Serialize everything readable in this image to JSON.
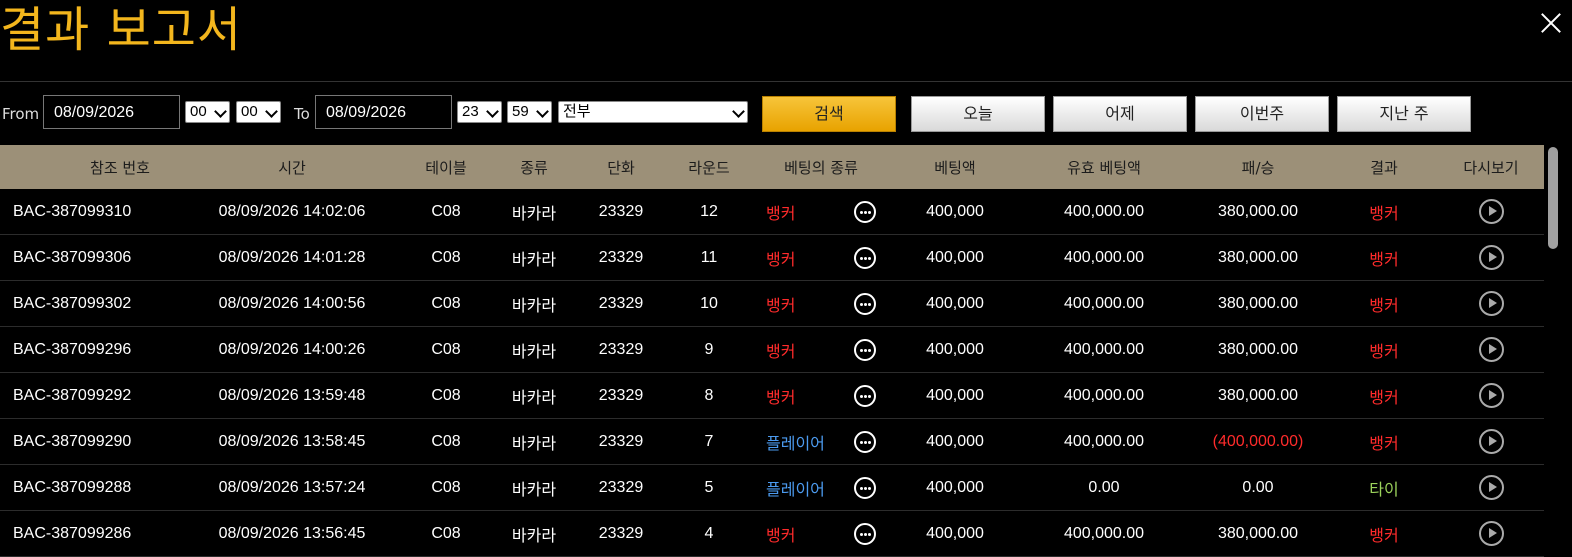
{
  "title": "결과 보고서",
  "filter": {
    "from_label": "From",
    "from_date": "08/09/2026",
    "from_hour": "00",
    "from_min": "00",
    "to_label": "To",
    "to_date": "08/09/2026",
    "to_hour": "23",
    "to_min": "59",
    "type_value": "전부",
    "search_label": "검색",
    "today_label": "오늘",
    "yesterday_label": "어제",
    "this_week_label": "이번주",
    "last_week_label": "지난 주"
  },
  "columns": [
    "참조 번호",
    "시간",
    "테이블",
    "종류",
    "단화",
    "라운드",
    "베팅의 종류",
    "베팅액",
    "유효 베팅액",
    "패/승",
    "결과",
    "다시보기"
  ],
  "rows": [
    {
      "ref": "BAC-387099310",
      "time": "08/09/2026 14:02:06",
      "table": "C08",
      "kind": "바카라",
      "shoe": "23329",
      "round": "12",
      "bet": "뱅커",
      "bet_color": "red",
      "amount": "400,000",
      "valid": "400,000.00",
      "winloss": "380,000.00",
      "winloss_color": "white",
      "result": "뱅커",
      "result_color": "red"
    },
    {
      "ref": "BAC-387099306",
      "time": "08/09/2026 14:01:28",
      "table": "C08",
      "kind": "바카라",
      "shoe": "23329",
      "round": "11",
      "bet": "뱅커",
      "bet_color": "red",
      "amount": "400,000",
      "valid": "400,000.00",
      "winloss": "380,000.00",
      "winloss_color": "white",
      "result": "뱅커",
      "result_color": "red"
    },
    {
      "ref": "BAC-387099302",
      "time": "08/09/2026 14:00:56",
      "table": "C08",
      "kind": "바카라",
      "shoe": "23329",
      "round": "10",
      "bet": "뱅커",
      "bet_color": "red",
      "amount": "400,000",
      "valid": "400,000.00",
      "winloss": "380,000.00",
      "winloss_color": "white",
      "result": "뱅커",
      "result_color": "red"
    },
    {
      "ref": "BAC-387099296",
      "time": "08/09/2026 14:00:26",
      "table": "C08",
      "kind": "바카라",
      "shoe": "23329",
      "round": "9",
      "bet": "뱅커",
      "bet_color": "red",
      "amount": "400,000",
      "valid": "400,000.00",
      "winloss": "380,000.00",
      "winloss_color": "white",
      "result": "뱅커",
      "result_color": "red"
    },
    {
      "ref": "BAC-387099292",
      "time": "08/09/2026 13:59:48",
      "table": "C08",
      "kind": "바카라",
      "shoe": "23329",
      "round": "8",
      "bet": "뱅커",
      "bet_color": "red",
      "amount": "400,000",
      "valid": "400,000.00",
      "winloss": "380,000.00",
      "winloss_color": "white",
      "result": "뱅커",
      "result_color": "red"
    },
    {
      "ref": "BAC-387099290",
      "time": "08/09/2026 13:58:45",
      "table": "C08",
      "kind": "바카라",
      "shoe": "23329",
      "round": "7",
      "bet": "플레이어",
      "bet_color": "blue",
      "amount": "400,000",
      "valid": "400,000.00",
      "winloss": "(400,000.00)",
      "winloss_color": "red",
      "result": "뱅커",
      "result_color": "red"
    },
    {
      "ref": "BAC-387099288",
      "time": "08/09/2026 13:57:24",
      "table": "C08",
      "kind": "바카라",
      "shoe": "23329",
      "round": "5",
      "bet": "플레이어",
      "bet_color": "blue",
      "amount": "400,000",
      "valid": "0.00",
      "winloss": "0.00",
      "winloss_color": "white",
      "result": "타이",
      "result_color": "green"
    },
    {
      "ref": "BAC-387099286",
      "time": "08/09/2026 13:56:45",
      "table": "C08",
      "kind": "바카라",
      "shoe": "23329",
      "round": "4",
      "bet": "뱅커",
      "bet_color": "red",
      "amount": "400,000",
      "valid": "400,000.00",
      "winloss": "380,000.00",
      "winloss_color": "white",
      "result": "뱅커",
      "result_color": "red"
    }
  ],
  "icons": {
    "close": "close-icon",
    "details": "more-options-icon",
    "replay": "play-icon"
  }
}
